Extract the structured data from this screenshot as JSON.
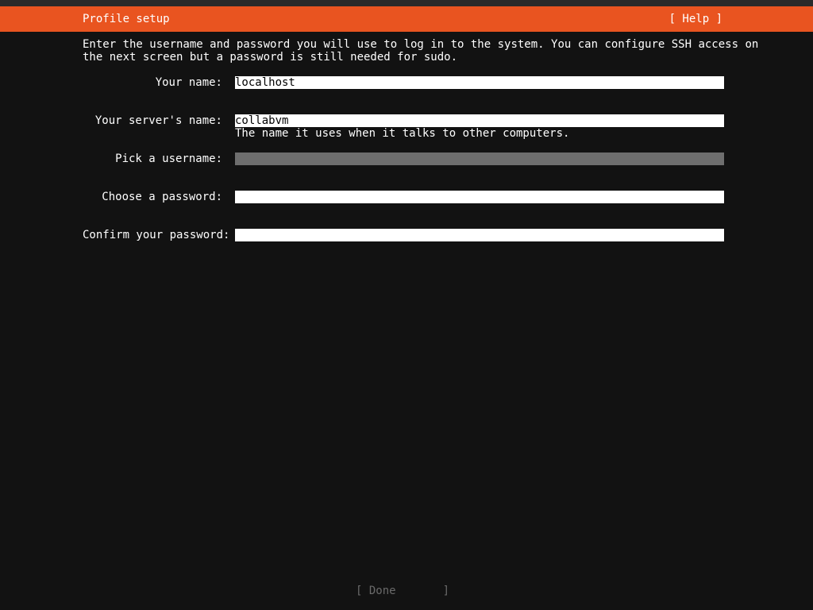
{
  "header": {
    "title": "Profile setup",
    "help_label": "[ Help ]"
  },
  "intro": {
    "line1": "Enter the username and password you will use to log in to the system. You can configure SSH access on",
    "line2": "the next screen but a password is still needed for sudo."
  },
  "form": {
    "name": {
      "label": "Your name:",
      "value": "localhost"
    },
    "server_name": {
      "label": "Your server's name:",
      "value": "collabvm",
      "hint": "The name it uses when it talks to other computers."
    },
    "username": {
      "label": "Pick a username:",
      "value": ""
    },
    "password": {
      "label": "Choose a password:",
      "value": ""
    },
    "confirm_password": {
      "label": "Confirm your password:",
      "value": ""
    }
  },
  "footer": {
    "done_label": "[ Done       ]"
  },
  "colors": {
    "accent": "#e95420",
    "background": "#121212",
    "focused_field": "#6e6e6e",
    "disabled_text": "#6a6a6a"
  }
}
